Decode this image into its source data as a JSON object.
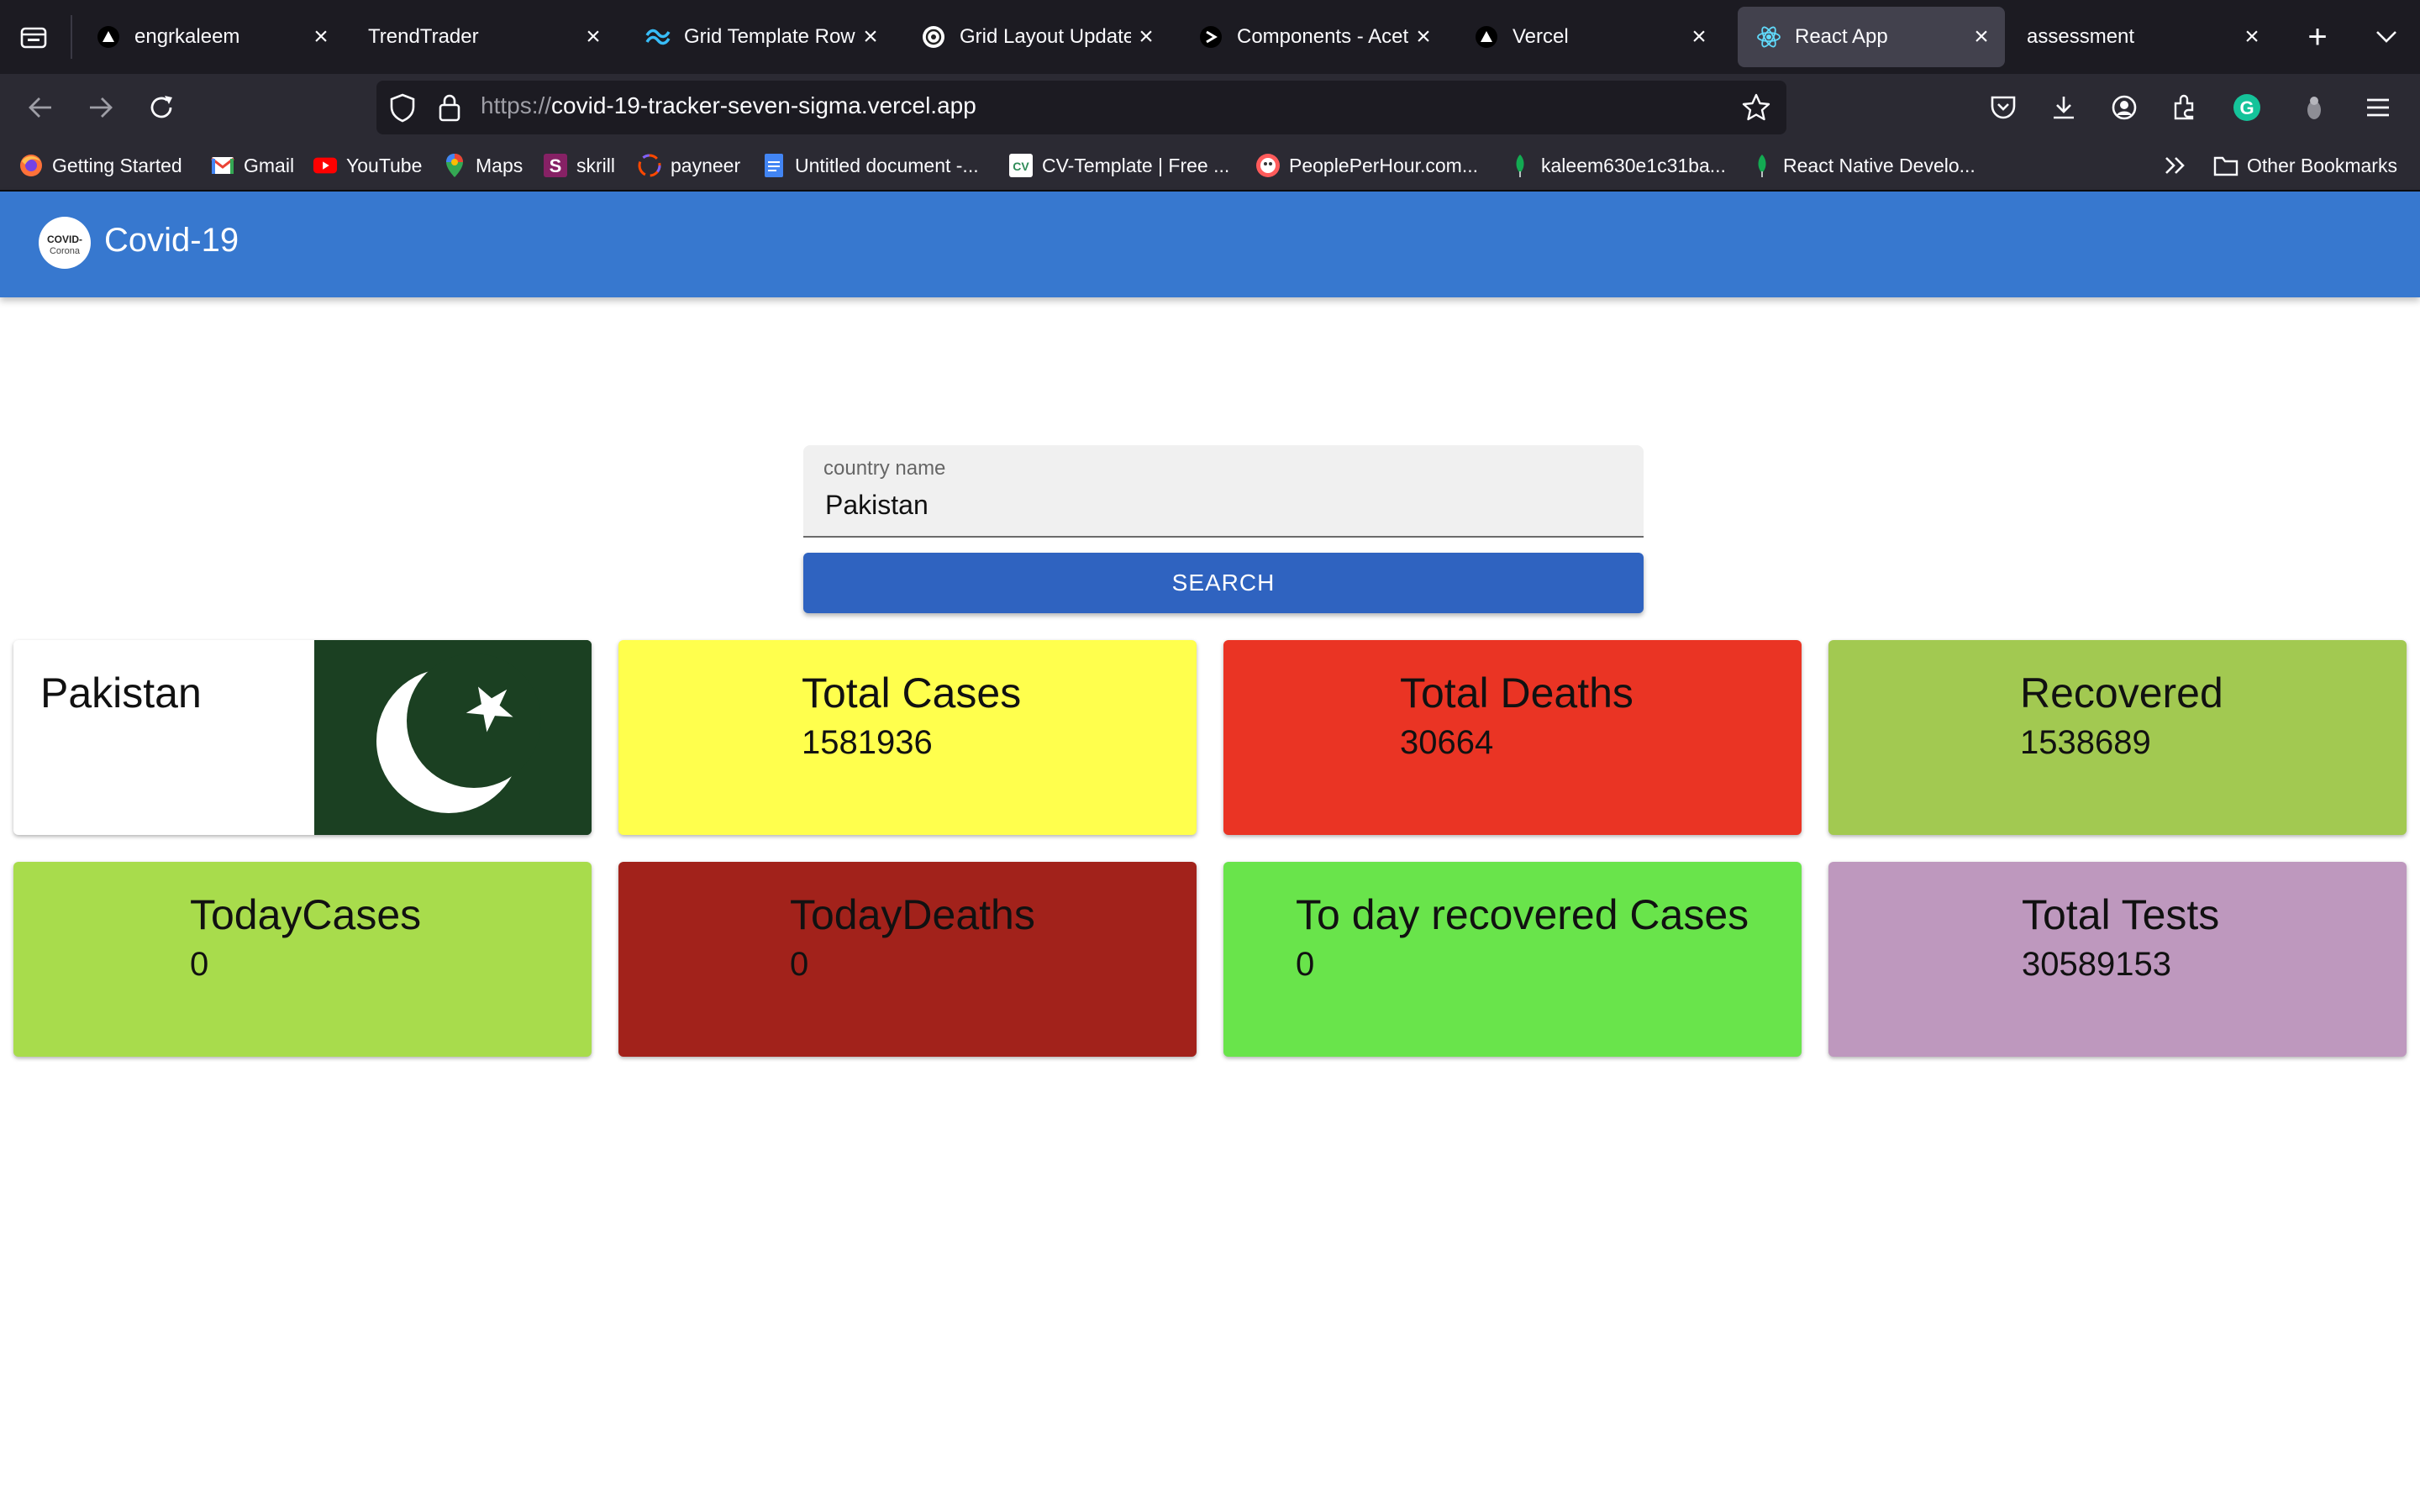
{
  "browser": {
    "tabs": [
      {
        "title": "engrkaleem",
        "icon": "vercel-triangle-icon",
        "active": false
      },
      {
        "title": "TrendTrader",
        "icon": "",
        "active": false
      },
      {
        "title": "Grid Template Rows",
        "icon": "tailwind-icon",
        "active": false
      },
      {
        "title": "Grid Layout Update",
        "icon": "openai-icon",
        "active": false
      },
      {
        "title": "Components - Acete",
        "icon": "aceternity-icon",
        "active": false
      },
      {
        "title": "Vercel",
        "icon": "vercel-triangle-icon",
        "active": false
      },
      {
        "title": "React App",
        "icon": "react-icon",
        "active": true
      },
      {
        "title": "assessment",
        "icon": "",
        "active": false
      }
    ],
    "url": {
      "protocol": "https://",
      "host": "covid-19-tracker-seven-sigma.vercel.app"
    },
    "bookmarks": [
      {
        "label": "Getting Started",
        "icon": "firefox-icon"
      },
      {
        "label": "Gmail",
        "icon": "gmail-icon"
      },
      {
        "label": "YouTube",
        "icon": "youtube-icon"
      },
      {
        "label": "Maps",
        "icon": "maps-pin-icon"
      },
      {
        "label": "skrill",
        "icon": "skrill-icon"
      },
      {
        "label": "payneer",
        "icon": "payoneer-icon"
      },
      {
        "label": "Untitled document -...",
        "icon": "google-docs-icon"
      },
      {
        "label": "CV-Template | Free ...",
        "icon": "cv-icon"
      },
      {
        "label": "PeoplePerHour.com...",
        "icon": "peopleperhour-icon"
      },
      {
        "label": "kaleem630e1c31ba...",
        "icon": "mongodb-leaf-icon"
      },
      {
        "label": "React Native Develo...",
        "icon": "mongodb-leaf-icon"
      }
    ],
    "other_bookmarks": "Other Bookmarks"
  },
  "app": {
    "title": "Covid-19",
    "logo_text_top": "COVID-",
    "logo_text_bottom": "Corona"
  },
  "search": {
    "label": "country name",
    "value": "Pakistan",
    "button": "SEARCH"
  },
  "country": {
    "name": "Pakistan",
    "flag": "pakistan-flag"
  },
  "stats": [
    {
      "title": "Total Cases",
      "value": "1581936",
      "color": "#ffff4d"
    },
    {
      "title": "Total Deaths",
      "value": "30664",
      "color": "#ea3424"
    },
    {
      "title": "Recovered",
      "value": "1538689",
      "color": "#a2c951"
    },
    {
      "title": "TodayCases",
      "value": "0",
      "color": "#a8dc4c"
    },
    {
      "title": "TodayDeaths",
      "value": "0",
      "color": "#a2221b"
    },
    {
      "title": "To day recovered Cases",
      "value": "0",
      "color": "#69e44b"
    },
    {
      "title": "Total Tests",
      "value": "30589153",
      "color": "#be98be"
    }
  ]
}
